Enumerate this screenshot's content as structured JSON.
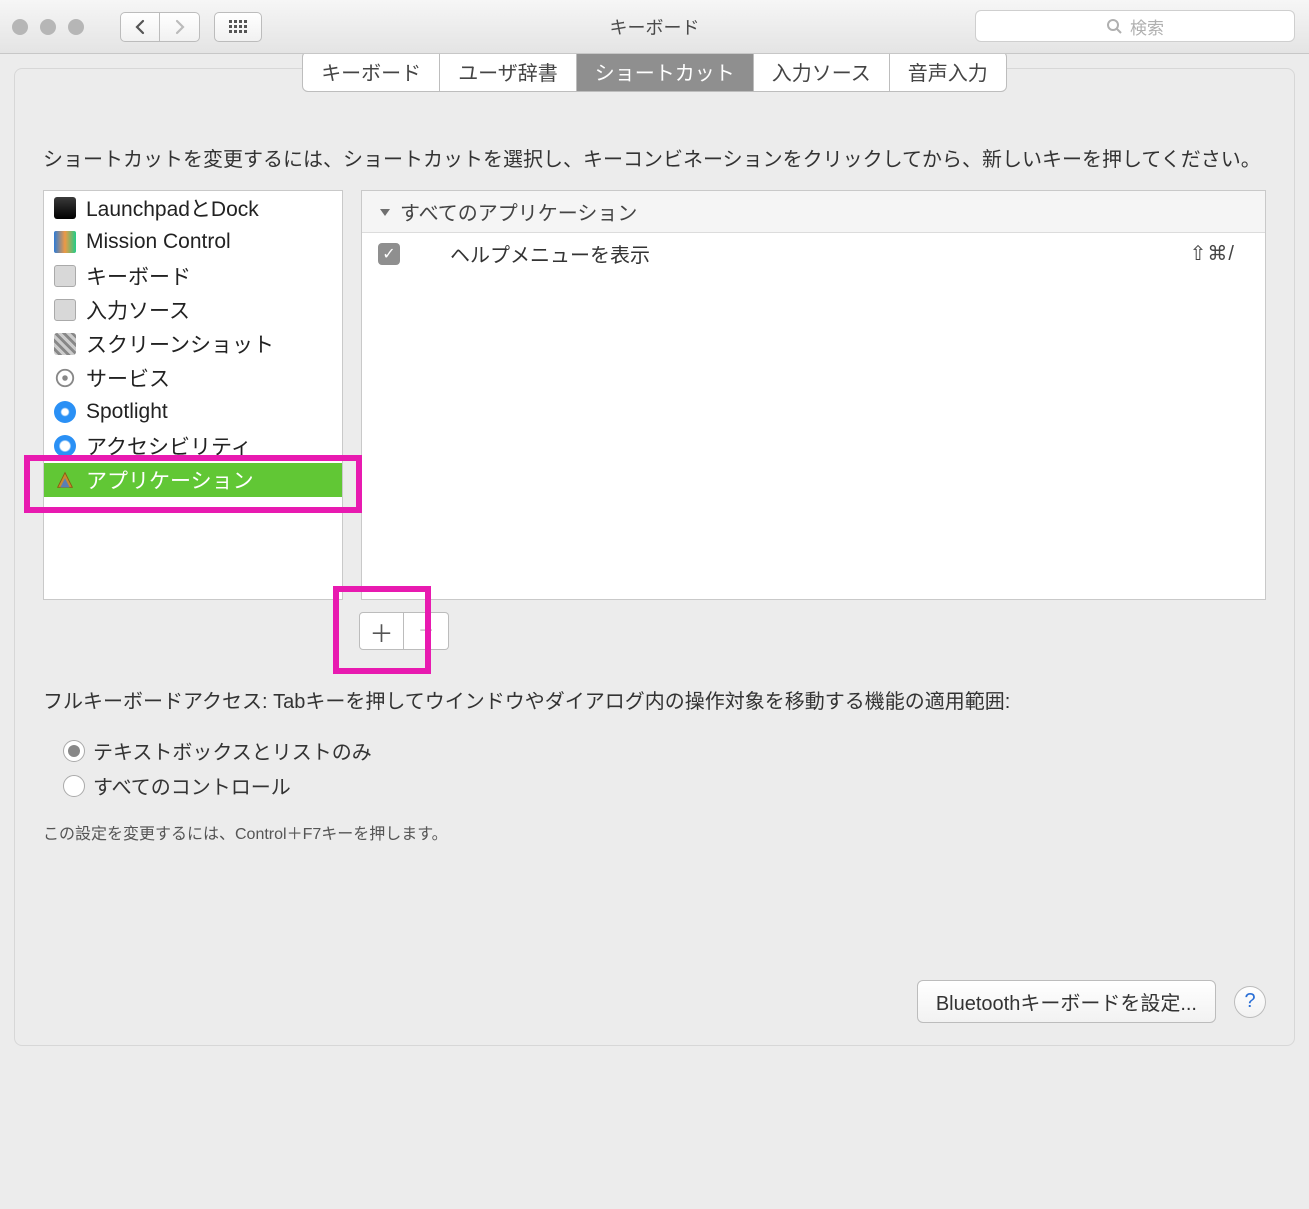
{
  "window_title": "キーボード",
  "search": {
    "placeholder": "検索"
  },
  "tabs": {
    "keyboard": "キーボード",
    "userdict": "ユーザ辞書",
    "shortcuts": "ショートカット",
    "inputsrc": "入力ソース",
    "dictation": "音声入力"
  },
  "instructions": "ショートカットを変更するには、ショートカットを選択し、キーコンビネーションをクリックしてから、新しいキーを押してください。",
  "categories": [
    "LaunchpadとDock",
    "Mission Control",
    "キーボード",
    "入力ソース",
    "スクリーンショット",
    "サービス",
    "Spotlight",
    "アクセシビリティ",
    "アプリケーション"
  ],
  "selected_category_index": 8,
  "shortcut_group_header": "すべてのアプリケーション",
  "shortcut_rows": [
    {
      "enabled": true,
      "label": "ヘルプメニューを表示",
      "keys": "⇧⌘/"
    }
  ],
  "add_label": "＋",
  "remove_label": "−",
  "fka_text": "フルキーボードアクセス: Tabキーを押してウインドウやダイアログ内の操作対象を移動する機能の適用範囲:",
  "fka_options": {
    "textlist": "テキストボックスとリストのみ",
    "all": "すべてのコントロール"
  },
  "fka_selected": "textlist",
  "fka_hint": "この設定を変更するには、Control＋F7キーを押します。",
  "bluetooth_button": "Bluetoothキーボードを設定..."
}
